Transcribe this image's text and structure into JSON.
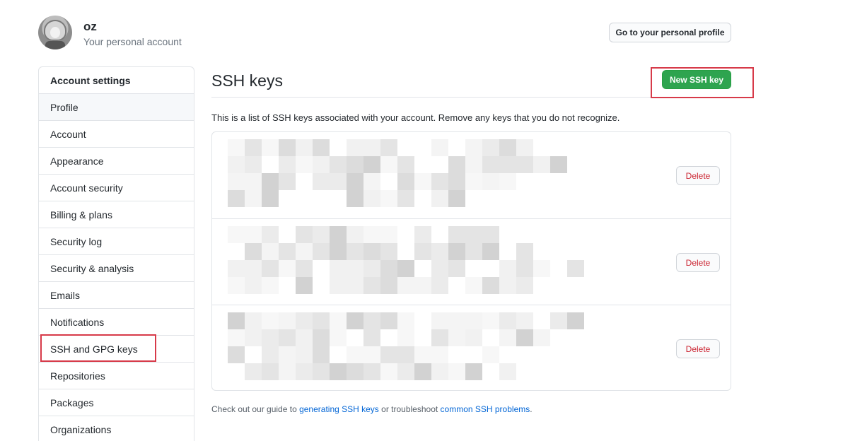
{
  "user": {
    "name": "oz",
    "subtitle": "Your personal account",
    "profile_button": "Go to your personal profile"
  },
  "sidebar": {
    "heading": "Account settings",
    "items": [
      {
        "label": "Profile",
        "active": true
      },
      {
        "label": "Account"
      },
      {
        "label": "Appearance"
      },
      {
        "label": "Account security"
      },
      {
        "label": "Billing & plans"
      },
      {
        "label": "Security log"
      },
      {
        "label": "Security & analysis"
      },
      {
        "label": "Emails"
      },
      {
        "label": "Notifications"
      },
      {
        "label": "SSH and GPG keys",
        "highlighted": true
      },
      {
        "label": "Repositories"
      },
      {
        "label": "Packages"
      },
      {
        "label": "Organizations"
      }
    ]
  },
  "main": {
    "title": "SSH keys",
    "new_key_button": "New SSH key",
    "intro": "This is a list of SSH keys associated with your account. Remove any keys that you do not recognize.",
    "keys": [
      {
        "redacted": true,
        "delete_label": "Delete"
      },
      {
        "redacted": true,
        "delete_label": "Delete"
      },
      {
        "redacted": true,
        "delete_label": "Delete"
      }
    ],
    "guide": {
      "prefix": "Check out our guide to ",
      "link1": "generating SSH keys",
      "middle": " or troubleshoot ",
      "link2": "common SSH problems",
      "suffix": "."
    }
  },
  "colors": {
    "primary_green": "#2ea44f",
    "danger_red": "#cb2431",
    "link_blue": "#0366d6",
    "highlight_red": "#d73a49"
  }
}
